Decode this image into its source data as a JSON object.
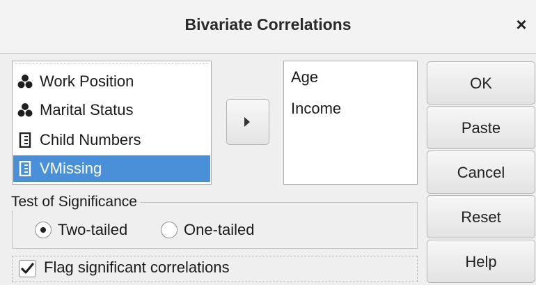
{
  "dialog": {
    "title": "Bivariate Correlations",
    "close_glyph": "×"
  },
  "source_variables": [
    {
      "label": "Work Position",
      "icon": "nominal-icon",
      "selected": false
    },
    {
      "label": "Marital Status",
      "icon": "nominal-icon",
      "selected": false
    },
    {
      "label": "Child Numbers",
      "icon": "scale-icon",
      "selected": false
    },
    {
      "label": "VMissing",
      "icon": "scale-icon",
      "selected": true
    }
  ],
  "target_variables": [
    "Age",
    "Income"
  ],
  "move_button": {
    "icon": "arrow-right-icon"
  },
  "buttons": {
    "ok": "OK",
    "paste": "Paste",
    "cancel": "Cancel",
    "reset": "Reset",
    "help": "Help"
  },
  "significance": {
    "legend": "Test of Significance",
    "options": [
      {
        "label": "Two-tailed",
        "selected": true
      },
      {
        "label": "One-tailed",
        "selected": false
      }
    ]
  },
  "flag_option": {
    "label": "Flag significant correlations",
    "checked": true
  },
  "colors": {
    "selection": "#4a90d9",
    "background": "#efefef"
  }
}
